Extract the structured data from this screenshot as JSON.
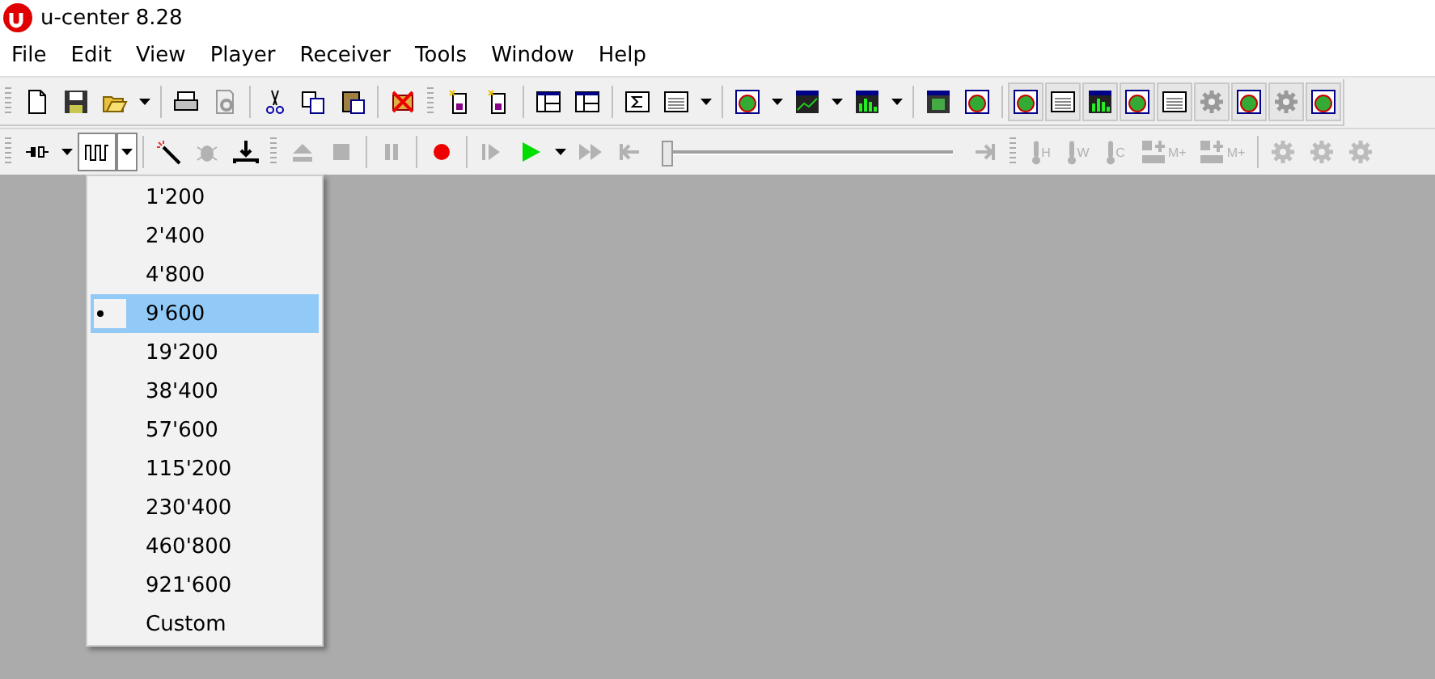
{
  "window": {
    "title": "u-center 8.28"
  },
  "menu_bar": [
    "File",
    "Edit",
    "View",
    "Player",
    "Receiver",
    "Tools",
    "Window",
    "Help"
  ],
  "toolbar_2": {
    "buttons": [
      {
        "disabled": false,
        "pressed": false
      },
      {
        "disabled": false,
        "pressed": true
      },
      {
        "disabled": false,
        "pressed": false
      },
      {
        "disabled": true,
        "pressed": false
      },
      {
        "disabled": false,
        "pressed": false
      },
      {
        "disabled": true,
        "pressed": false
      },
      {
        "disabled": true,
        "pressed": false
      },
      {
        "disabled": true,
        "pressed": false
      },
      {
        "disabled": false,
        "pressed": false
      },
      {
        "disabled": true,
        "pressed": false
      },
      {
        "disabled": false,
        "pressed": false
      },
      {
        "disabled": true,
        "pressed": false
      },
      {
        "disabled": true,
        "pressed": false
      },
      {
        "disabled": true,
        "pressed": false
      },
      {
        "disabled": true,
        "pressed": false,
        "label": "H"
      },
      {
        "disabled": true,
        "pressed": false,
        "label": "W"
      },
      {
        "disabled": true,
        "pressed": false,
        "label": "C"
      },
      {
        "disabled": true,
        "pressed": false,
        "label": "M+"
      },
      {
        "disabled": true,
        "pressed": false,
        "label": "M+"
      },
      {
        "disabled": true,
        "pressed": false
      },
      {
        "disabled": true,
        "pressed": false
      },
      {
        "disabled": true,
        "pressed": false
      }
    ],
    "slider": {
      "level": 0
    }
  },
  "baud_menu": [
    {
      "label": "1'200",
      "selected": false
    },
    {
      "label": "2'400",
      "selected": false
    },
    {
      "label": "4'800",
      "selected": false
    },
    {
      "label": "9'600",
      "selected": true
    },
    {
      "label": "19'200",
      "selected": false
    },
    {
      "label": "38'400",
      "selected": false
    },
    {
      "label": "57'600",
      "selected": false
    },
    {
      "label": "115'200",
      "selected": false
    },
    {
      "label": "230'400",
      "selected": false
    },
    {
      "label": "460'800",
      "selected": false
    },
    {
      "label": "921'600",
      "selected": false
    },
    {
      "label": "Custom",
      "selected": false
    }
  ]
}
